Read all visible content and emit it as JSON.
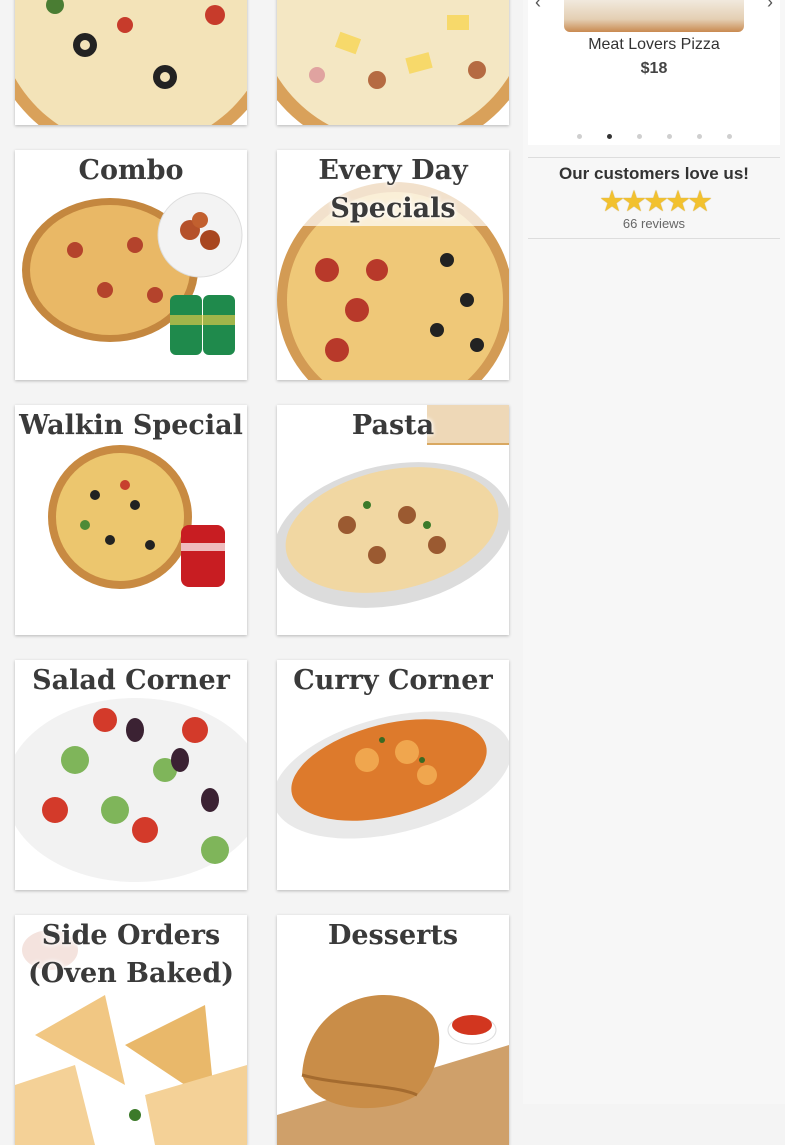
{
  "menu": {
    "categories": [
      {
        "title": ""
      },
      {
        "title": ""
      },
      {
        "title": "Combo"
      },
      {
        "title": "Every Day Specials"
      },
      {
        "title": "Walkin Special"
      },
      {
        "title": "Pasta"
      },
      {
        "title": "Salad Corner"
      },
      {
        "title": "Curry Corner"
      },
      {
        "title": "Side Orders (Oven Baked)"
      },
      {
        "title": "Desserts"
      }
    ]
  },
  "slider": {
    "item_name": "Meat Lovers Pizza",
    "item_price": "$18",
    "prev_icon": "chevron-left-icon",
    "next_icon": "chevron-right-icon",
    "dot_count": 6,
    "active_dot": 1
  },
  "reviews": {
    "heading": "Our customers love us!",
    "rating": 5,
    "star_glyphs": "★★★★★",
    "count_text": "66 reviews"
  },
  "colors": {
    "title_text": "#3a3a3a",
    "star": "#f2c12e",
    "card_bg": "#ffffff",
    "page_bg": "#f4f4f4"
  }
}
